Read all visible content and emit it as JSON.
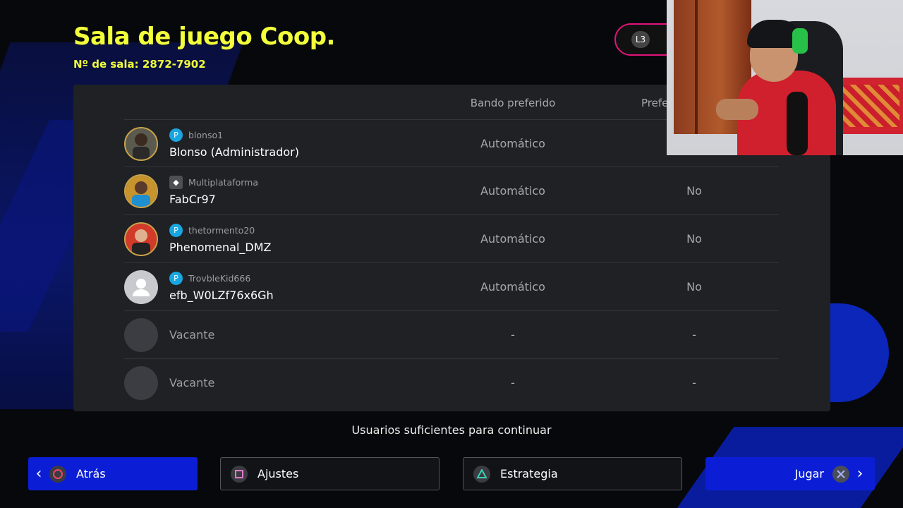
{
  "header": {
    "title": "Sala de juego Coop.",
    "room_number": "Nº de sala: 2872-7902",
    "l3_label": "L3"
  },
  "table": {
    "columns": [
      "Bando preferido",
      "Prefe"
    ],
    "rows": [
      {
        "platform": "blonso1",
        "platform_icon": "playstation-icon",
        "name": "Blonso (Administrador)",
        "side": "Automático",
        "pref": ""
      },
      {
        "platform": "Multiplataforma",
        "platform_icon": "gamepad-icon",
        "name": "FabCr97",
        "side": "Automático",
        "pref": "No"
      },
      {
        "platform": "thetormento20",
        "platform_icon": "playstation-icon",
        "name": "Phenomenal_DMZ",
        "side": "Automático",
        "pref": "No"
      },
      {
        "platform": "TrovbleKid666",
        "platform_icon": "playstation-icon",
        "name": "efb_W0LZf76x6Gh",
        "side": "Automático",
        "pref": "No"
      },
      {
        "platform": "",
        "platform_icon": "",
        "name": "Vacante",
        "side": "-",
        "pref": "-"
      },
      {
        "platform": "",
        "platform_icon": "",
        "name": "Vacante",
        "side": "-",
        "pref": "-"
      }
    ]
  },
  "status_message": "Usuarios suficientes para continuar",
  "footer": {
    "back_label": "Atrás",
    "settings_label": "Ajustes",
    "strategy_label": "Estrategia",
    "play_label": "Jugar"
  },
  "colors": {
    "title": "#f2ff3a",
    "accent_blue": "#0b1ed6",
    "l3_border": "#e0137a",
    "panel": "#1f2125"
  }
}
